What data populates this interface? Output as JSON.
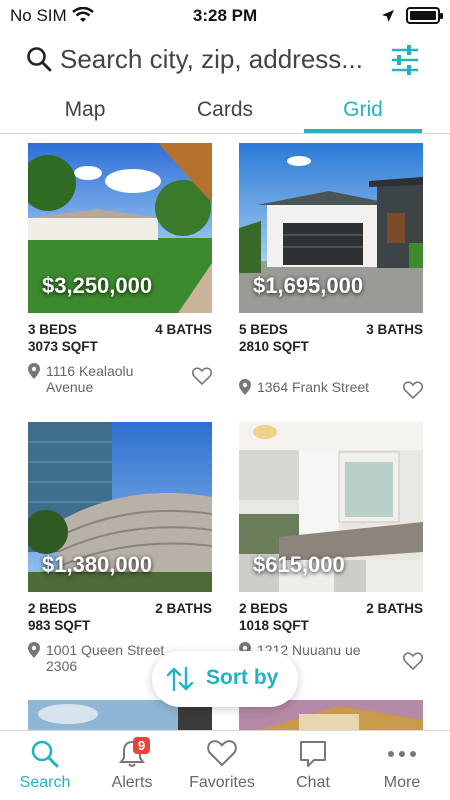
{
  "status_bar": {
    "carrier": "No SIM",
    "time": "3:28 PM"
  },
  "search": {
    "placeholder": "Search city, zip, address..."
  },
  "tabs": [
    {
      "label": "Map"
    },
    {
      "label": "Cards"
    },
    {
      "label": "Grid",
      "active": true
    }
  ],
  "listings": [
    {
      "price": "$3,250,000",
      "beds": "3 BEDS",
      "baths": "4 BATHS",
      "sqft": "3073 SQFT",
      "address": "1116 Kealaolu Avenue"
    },
    {
      "price": "$1,695,000",
      "beds": "5 BEDS",
      "baths": "3 BATHS",
      "sqft": "2810 SQFT",
      "address": "1364 Frank Street"
    },
    {
      "price": "$1,380,000",
      "beds": "2 BEDS",
      "baths": "2 BATHS",
      "sqft": "983 SQFT",
      "address": "1001 Queen Street 2306"
    },
    {
      "price": "$615,000",
      "beds": "2 BEDS",
      "baths": "2 BATHS",
      "sqft": "1018 SQFT",
      "address": "1212 Nuuanu ue 1908"
    }
  ],
  "sort": {
    "label": "Sort by"
  },
  "nav": [
    {
      "label": "Search",
      "icon": "search-icon",
      "active": true
    },
    {
      "label": "Alerts",
      "icon": "bell-icon",
      "badge": "9"
    },
    {
      "label": "Favorites",
      "icon": "heart-icon"
    },
    {
      "label": "Chat",
      "icon": "chat-icon"
    },
    {
      "label": "More",
      "icon": "more-icon"
    }
  ],
  "colors": {
    "accent": "#22b2c3",
    "badge": "#e8433f"
  }
}
